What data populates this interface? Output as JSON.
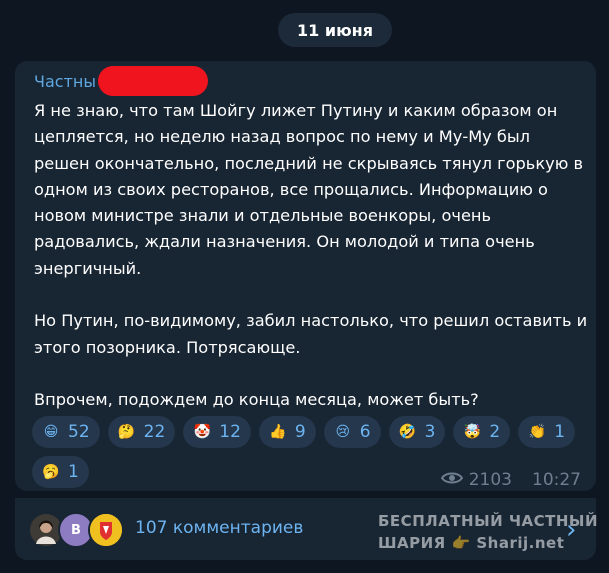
{
  "date_label": "11 июня",
  "post": {
    "sender_visible": "Частны            АРИЯ",
    "paragraphs": [
      "Я не знаю, что там Шойгу лижет Путину и каким образом он цепляется, но неделю назад вопрос по нему и Му-Му был решен окончательно, последний не скрываясь тянул горькую в одном из своих ресторанов, все прощались. Информацию о новом министре знали и отдельные военкоры, очень радовались, ждали назначения. Он молодой и типа очень энергичный.",
      "Но Путин, по-видимому, забил настолько, что решил оставить и этого позорника. Потрясающе.",
      "Впрочем, подождем до конца месяца, может быть?"
    ],
    "reactions": [
      {
        "emoji": "😁",
        "icon": "grinning-face-icon",
        "count": "52"
      },
      {
        "emoji": "🤔",
        "icon": "thinking-face-icon",
        "count": "22"
      },
      {
        "emoji": "🤡",
        "icon": "clown-face-icon",
        "count": "12"
      },
      {
        "emoji": "👍",
        "icon": "thumbs-up-icon",
        "count": "9"
      },
      {
        "emoji": "😢",
        "icon": "crying-face-icon",
        "count": "6"
      },
      {
        "emoji": "🤣",
        "icon": "rolling-laughing-icon",
        "count": "3"
      },
      {
        "emoji": "🤯",
        "icon": "exploding-head-icon",
        "count": "2"
      },
      {
        "emoji": "👏",
        "icon": "clapping-hands-icon",
        "count": "1"
      },
      {
        "emoji": "🥱",
        "icon": "yawning-face-icon",
        "count": "1"
      }
    ],
    "views": "2103",
    "time": "10:27"
  },
  "comments": {
    "label": "107 комментариев",
    "avatars": [
      {
        "icon": "user-photo-avatar",
        "letter": ""
      },
      {
        "icon": "letter-avatar",
        "letter": "В"
      },
      {
        "icon": "emblem-avatar",
        "letter": ""
      }
    ]
  },
  "watermark": {
    "line1": "БЕСПЛАТНЫЙ ЧАСТНЫЙ",
    "line2": "ШАРИЯ 👉 Sharij.net"
  },
  "colors": {
    "background": "#0e1621",
    "bubble": "#182533",
    "accent": "#6db4f1",
    "redaction": "#f0141e"
  }
}
